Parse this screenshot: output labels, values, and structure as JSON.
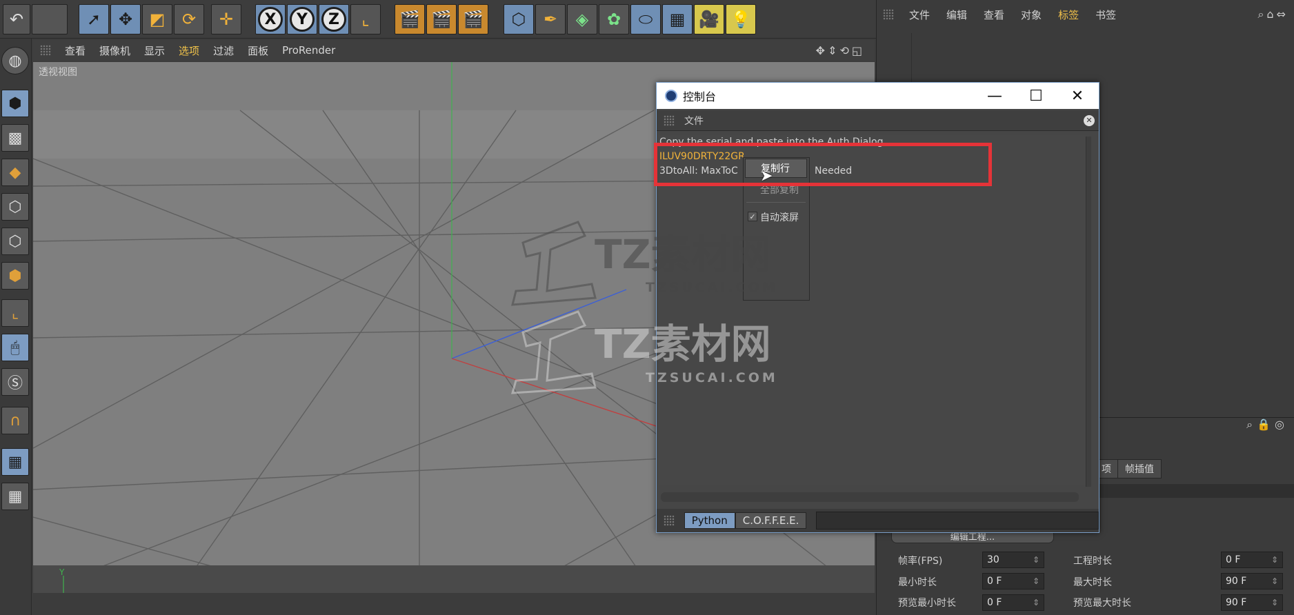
{
  "toolbar": {
    "undo_icon": "undo-icon",
    "axis_x": "X",
    "axis_y": "Y",
    "axis_z": "Z"
  },
  "viewport": {
    "menu": [
      {
        "label": "查看",
        "active": false
      },
      {
        "label": "摄像机",
        "active": false
      },
      {
        "label": "显示",
        "active": false
      },
      {
        "label": "选项",
        "active": true
      },
      {
        "label": "过滤",
        "active": false
      },
      {
        "label": "面板",
        "active": false
      },
      {
        "label": "ProRender",
        "active": false
      }
    ],
    "view_label": "透视视图",
    "axis_label": "Y"
  },
  "object_manager": {
    "menu": [
      {
        "label": "文件",
        "active": false
      },
      {
        "label": "编辑",
        "active": false
      },
      {
        "label": "查看",
        "active": false
      },
      {
        "label": "对象",
        "active": false
      },
      {
        "label": "标签",
        "active": true
      },
      {
        "label": "书签",
        "active": false
      }
    ]
  },
  "attributes": {
    "tabs": [
      "项",
      "帧插值"
    ],
    "button": "编辑工程...",
    "rows": [
      {
        "label": "帧率(FPS)",
        "value": "30",
        "label2": "工程时长",
        "value2": "0 F"
      },
      {
        "label": "最小时长",
        "value": "0 F",
        "label2": "最大时长",
        "value2": "90 F"
      },
      {
        "label": "预览最小时长",
        "value": "0 F",
        "label2": "预览最大时长",
        "value2": "90 F"
      }
    ]
  },
  "console": {
    "title": "控制台",
    "menu_file": "文件",
    "line1": "Copy the serial and paste into the Auth Dialog",
    "line2": "ILUV90DRTY22GR",
    "line3a": "3DtoAll: MaxToC",
    "line3b": "Needed",
    "tab_python": "Python",
    "tab_coffee": "C.O.F.F.E.E.",
    "colors": {
      "serial": "#f2b33a",
      "highlight": "#e53338"
    }
  },
  "context_menu": {
    "copy_line": "复制行",
    "copy_all": "全部复制",
    "auto_scroll": "自动滚屏",
    "auto_scroll_checked": true
  },
  "watermark": {
    "brand": "TZ素材网",
    "domain": "TZSUCAI.COM"
  }
}
